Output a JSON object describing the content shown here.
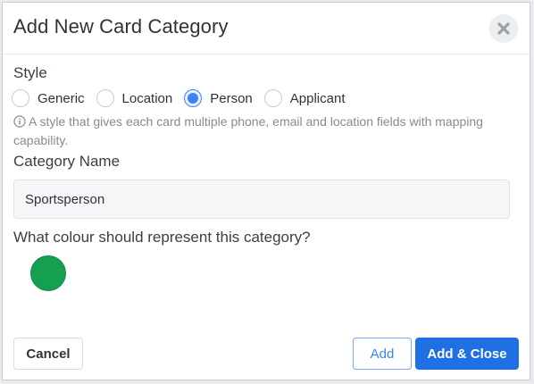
{
  "dialog": {
    "title": "Add New Card Category",
    "close_icon": "close-icon"
  },
  "style": {
    "label": "Style",
    "options": [
      {
        "label": "Generic",
        "selected": false
      },
      {
        "label": "Location",
        "selected": false
      },
      {
        "label": "Person",
        "selected": true
      },
      {
        "label": "Applicant",
        "selected": false
      }
    ],
    "help_icon": "info-circle-icon",
    "help_text": "A style that gives each card multiple phone, email and location fields with mapping capability."
  },
  "category_name": {
    "label": "Category Name",
    "value": "Sportsperson"
  },
  "colour": {
    "label": "What colour should represent this category?",
    "selected_color": "#15a04f"
  },
  "footer": {
    "cancel_label": "Cancel",
    "add_label": "Add",
    "add_close_label": "Add & Close"
  },
  "colors": {
    "accent": "#1f6fe5",
    "radio_selected": "#3b82f6"
  }
}
